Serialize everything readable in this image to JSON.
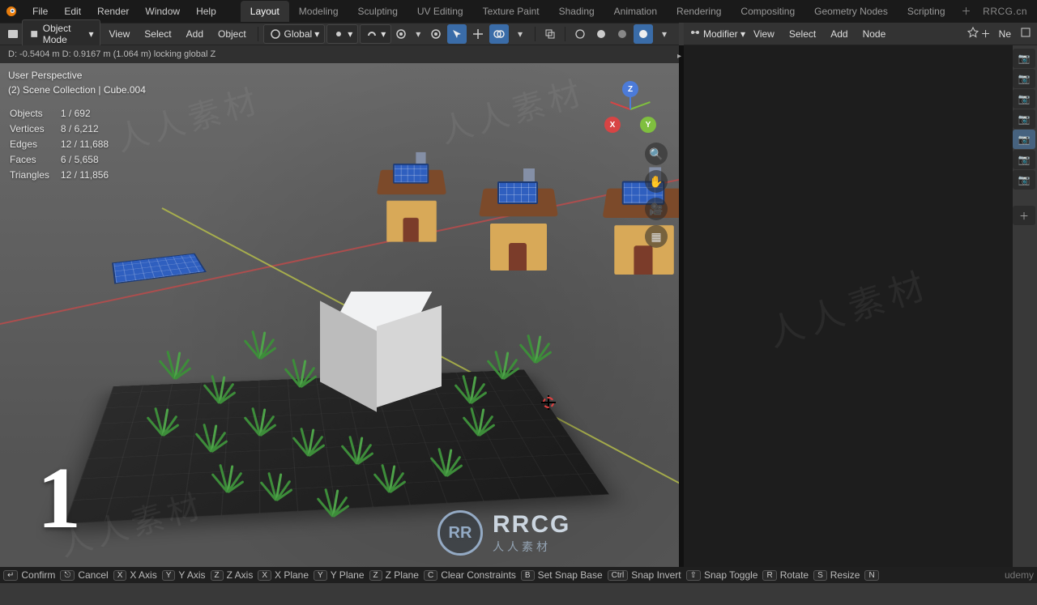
{
  "brand": "RRCG.cn",
  "menus": {
    "file": "File",
    "edit": "Edit",
    "render": "Render",
    "window": "Window",
    "help": "Help"
  },
  "tabs": [
    "Layout",
    "Modeling",
    "Sculpting",
    "UV Editing",
    "Texture Paint",
    "Shading",
    "Animation",
    "Rendering",
    "Compositing",
    "Geometry Nodes",
    "Scripting"
  ],
  "active_tab": "Layout",
  "viewport_header": {
    "mode": "Object Mode",
    "menus": [
      "View",
      "Select",
      "Add",
      "Object"
    ],
    "orientation": "Global"
  },
  "node_header": {
    "dropdown": "Modifier",
    "menus": [
      "View",
      "Select",
      "Add",
      "Node"
    ],
    "right_label": "Ne"
  },
  "status_line": "D: -0.5404 m   D: 0.9167 m (1.064 m) locking global Z",
  "overlay": {
    "perspective": "User Perspective",
    "collection": "(2) Scene Collection | Cube.004"
  },
  "stats": {
    "Objects": "1 / 692",
    "Vertices": "8 / 6,212",
    "Edges": "12 / 11,688",
    "Faces": "6 / 5,658",
    "Triangles": "12 / 11,856"
  },
  "big_number": "1",
  "gizmo": {
    "x": "X",
    "y": "Y",
    "z": "Z"
  },
  "logo": {
    "badge": "RR",
    "title": "RRCG",
    "subtitle": "人人素材"
  },
  "bottom": {
    "confirm": "Confirm",
    "cancel": "Cancel",
    "xaxis": "X Axis",
    "yaxis": "Y Axis",
    "zaxis": "Z Axis",
    "xplane": "X Plane",
    "yplane": "Y Plane",
    "zplane": "Z Plane",
    "clear": "Clear Constraints",
    "snapbase": "Set Snap Base",
    "snapinv": "Snap Invert",
    "snaptog": "Snap Toggle",
    "rotate": "Rotate",
    "resize": "Resize",
    "udemy": "udemy"
  },
  "bottom_keys": {
    "confirm": "↵",
    "cancel": "⎋",
    "x": "X",
    "y": "Y",
    "z": "Z",
    "xp": "X",
    "yp": "Y",
    "zp": "Z",
    "c": "C",
    "b": "B",
    "ctrl": "Ctrl",
    "shift": "⇧",
    "r": "R",
    "s": "S",
    "n": "N"
  }
}
